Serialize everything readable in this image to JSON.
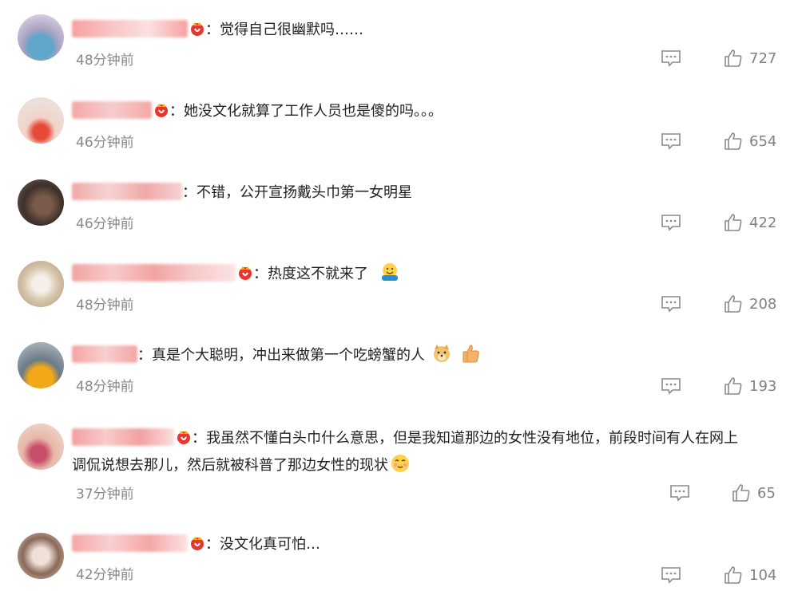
{
  "comments": [
    {
      "separator": "：",
      "text": "觉得自己很幽默吗……",
      "time": "48分钟前",
      "likes": "727",
      "colors": [
        "#f6a1a1",
        "#f9c4c4"
      ]
    },
    {
      "separator": "：",
      "text": "她没文化就算了工作人员也是傻的吗。。。",
      "time": "46分钟前",
      "likes": "654",
      "colors": [
        "#f3a7a7",
        "#f7cccc"
      ]
    },
    {
      "separator": "：",
      "text": "不错，公开宣扬戴头巾第一女明星",
      "time": "46分钟前",
      "likes": "422",
      "colors": [
        "#f0a9a9",
        "#f7d2d2"
      ]
    },
    {
      "separator": "：",
      "text": "热度这不就来了",
      "time": "48分钟前",
      "likes": "208",
      "colors": [
        "#f2a3a3",
        "#f8caca"
      ],
      "emoji_after": "hug-emoji"
    },
    {
      "separator": "：",
      "text": "真是个大聪明，冲出来做第一个吃螃蟹的人",
      "time": "48分钟前",
      "likes": "193",
      "colors": [
        "#f4a4a4",
        "#f8cfcf"
      ],
      "emoji_after": "doge-emoji, thumbs-up-emoji"
    },
    {
      "separator": "：",
      "text": "我虽然不懂白头巾什么意思，但是我知道那边的女性没有地位，前段时间有人在网上",
      "text2": "调侃说想去那儿，然后就被科普了那边女性的现状",
      "time": "37分钟前",
      "likes": "65",
      "colors": [
        "#f2a0a0",
        "#f8cbcb"
      ],
      "emoji_after": "shy-emoji"
    },
    {
      "separator": "：",
      "text": "没文化真可怕…",
      "time": "42分钟前",
      "likes": "104",
      "colors": [
        "#f5a6a6",
        "#f9d0d0"
      ]
    }
  ],
  "icons": {
    "reply": "comment-icon",
    "like": "thumbs-up-icon",
    "badge": "crown-badge-icon"
  },
  "theme": {
    "text": "#222222",
    "muted": "#888888",
    "icon": "#8a8a8a",
    "badge": "#e8362f",
    "badge_gold": "#f5b301"
  }
}
